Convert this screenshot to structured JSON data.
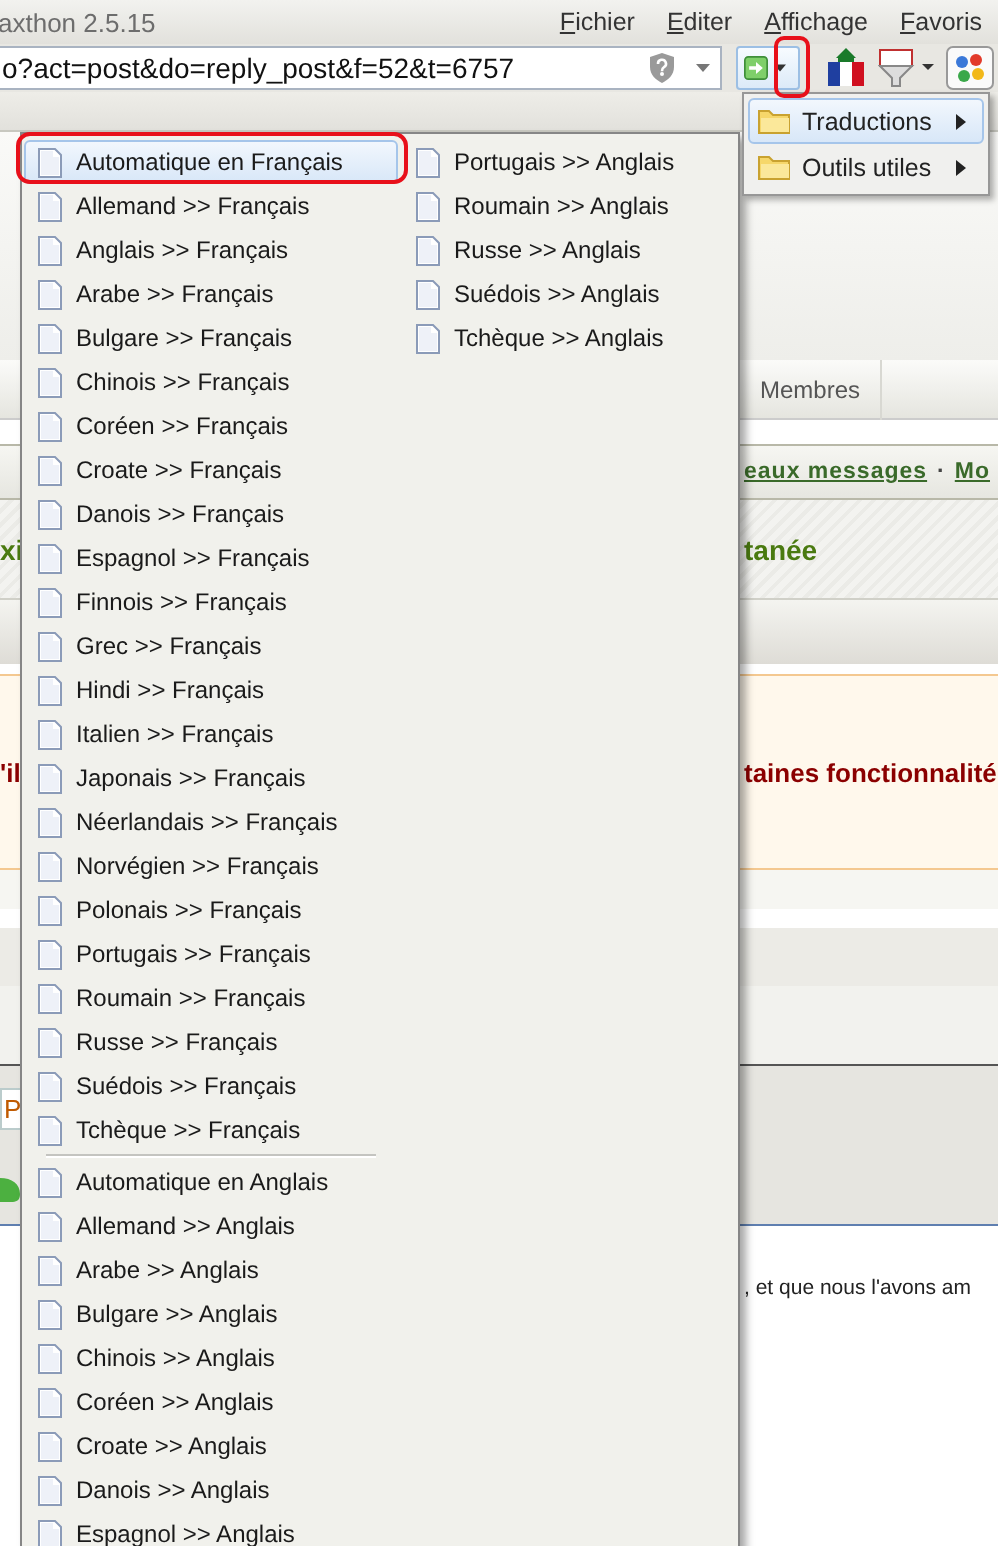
{
  "window": {
    "title": "axthon 2.5.15"
  },
  "menu_bar": [
    "Fichier",
    "Editer",
    "Affichage",
    "Favoris"
  ],
  "address_bar": {
    "url": "o?act=post&do=reply_post&f=52&t=6757"
  },
  "page": {
    "tab": "Membres",
    "links": [
      "eaux messages",
      "·",
      "Mo"
    ],
    "title_fragment": "tanée",
    "warning": "taines fonctionnalité",
    "body_text": ", et que nous l'avons am",
    "title_left": "xi",
    "warning_left": "'il",
    "panel_left": "P"
  },
  "tools_menu": [
    {
      "label": "Traductions",
      "selected": true
    },
    {
      "label": "Outils utiles",
      "selected": false
    }
  ],
  "translation_menu": {
    "columns": [
      [
        {
          "kind": "item",
          "label": "Automatique en Français",
          "selected": true
        },
        {
          "kind": "item",
          "label": "Allemand >> Français",
          "selected": false
        },
        {
          "kind": "item",
          "label": "Anglais >> Français",
          "selected": false
        },
        {
          "kind": "item",
          "label": "Arabe >> Français",
          "selected": false
        },
        {
          "kind": "item",
          "label": "Bulgare >> Français",
          "selected": false
        },
        {
          "kind": "item",
          "label": "Chinois >> Français",
          "selected": false
        },
        {
          "kind": "item",
          "label": "Coréen >> Français",
          "selected": false
        },
        {
          "kind": "item",
          "label": "Croate >> Français",
          "selected": false
        },
        {
          "kind": "item",
          "label": "Danois >> Français",
          "selected": false
        },
        {
          "kind": "item",
          "label": "Espagnol >> Français",
          "selected": false
        },
        {
          "kind": "item",
          "label": "Finnois >> Français",
          "selected": false
        },
        {
          "kind": "item",
          "label": "Grec >> Français",
          "selected": false
        },
        {
          "kind": "item",
          "label": "Hindi >> Français",
          "selected": false
        },
        {
          "kind": "item",
          "label": "Italien >> Français",
          "selected": false
        },
        {
          "kind": "item",
          "label": "Japonais >> Français",
          "selected": false
        },
        {
          "kind": "item",
          "label": "Néerlandais >> Français",
          "selected": false
        },
        {
          "kind": "item",
          "label": "Norvégien >> Français",
          "selected": false
        },
        {
          "kind": "item",
          "label": "Polonais >> Français",
          "selected": false
        },
        {
          "kind": "item",
          "label": "Portugais >> Français",
          "selected": false
        },
        {
          "kind": "item",
          "label": "Roumain >> Français",
          "selected": false
        },
        {
          "kind": "item",
          "label": "Russe >> Français",
          "selected": false
        },
        {
          "kind": "item",
          "label": "Suédois >> Français",
          "selected": false
        },
        {
          "kind": "item",
          "label": "Tchèque >> Français",
          "selected": false
        },
        {
          "kind": "separator"
        },
        {
          "kind": "item",
          "label": "Automatique en Anglais",
          "selected": false
        },
        {
          "kind": "item",
          "label": "Allemand >> Anglais",
          "selected": false
        },
        {
          "kind": "item",
          "label": "Arabe >> Anglais",
          "selected": false
        },
        {
          "kind": "item",
          "label": "Bulgare >> Anglais",
          "selected": false
        },
        {
          "kind": "item",
          "label": "Chinois >> Anglais",
          "selected": false
        },
        {
          "kind": "item",
          "label": "Coréen >> Anglais",
          "selected": false
        },
        {
          "kind": "item",
          "label": "Croate >> Anglais",
          "selected": false
        },
        {
          "kind": "item",
          "label": "Danois >> Anglais",
          "selected": false
        },
        {
          "kind": "item",
          "label": "Espagnol >> Anglais",
          "selected": false
        }
      ],
      [
        {
          "kind": "item",
          "label": "Portugais >> Anglais",
          "selected": false
        },
        {
          "kind": "item",
          "label": "Roumain >> Anglais",
          "selected": false
        },
        {
          "kind": "item",
          "label": "Russe >> Anglais",
          "selected": false
        },
        {
          "kind": "item",
          "label": "Suédois >> Anglais",
          "selected": false
        },
        {
          "kind": "item",
          "label": "Tchèque >> Anglais",
          "selected": false
        }
      ]
    ]
  }
}
